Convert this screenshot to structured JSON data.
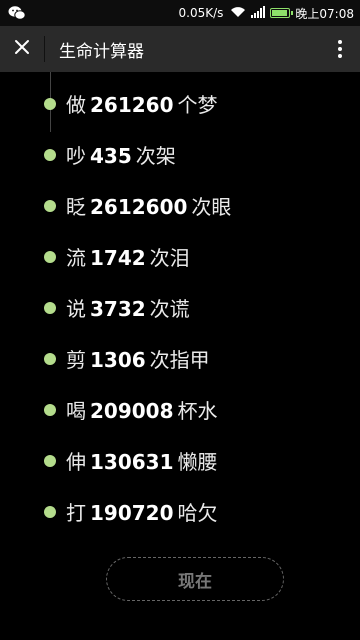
{
  "statusbar": {
    "left_icon": "wechat-icon",
    "speed": "0.05K/s",
    "wifi_icon": "wifi-icon",
    "signal_icon": "signal-icon",
    "battery_level": 1.0,
    "time": "晚上07:08"
  },
  "appbar": {
    "close_icon": "close-icon",
    "title": "生命计算器",
    "more_icon": "more-vertical-icon"
  },
  "items": [
    {
      "verb": "做",
      "number": "261260",
      "unit": "个梦"
    },
    {
      "verb": "吵",
      "number": "435",
      "unit": "次架"
    },
    {
      "verb": "眨",
      "number": "2612600",
      "unit": "次眼"
    },
    {
      "verb": "流",
      "number": "1742",
      "unit": "次泪"
    },
    {
      "verb": "说",
      "number": "3732",
      "unit": "次谎"
    },
    {
      "verb": "剪",
      "number": "1306",
      "unit": "次指甲"
    },
    {
      "verb": "喝",
      "number": "209008",
      "unit": "杯水"
    },
    {
      "verb": "伸",
      "number": "130631",
      "unit": "懒腰"
    },
    {
      "verb": "打",
      "number": "190720",
      "unit": "哈欠"
    }
  ],
  "colors": {
    "bullet": "#b4dc8c",
    "appbar": "#2a2a2a",
    "background": "#000000"
  },
  "now_button": {
    "label": "现在"
  }
}
